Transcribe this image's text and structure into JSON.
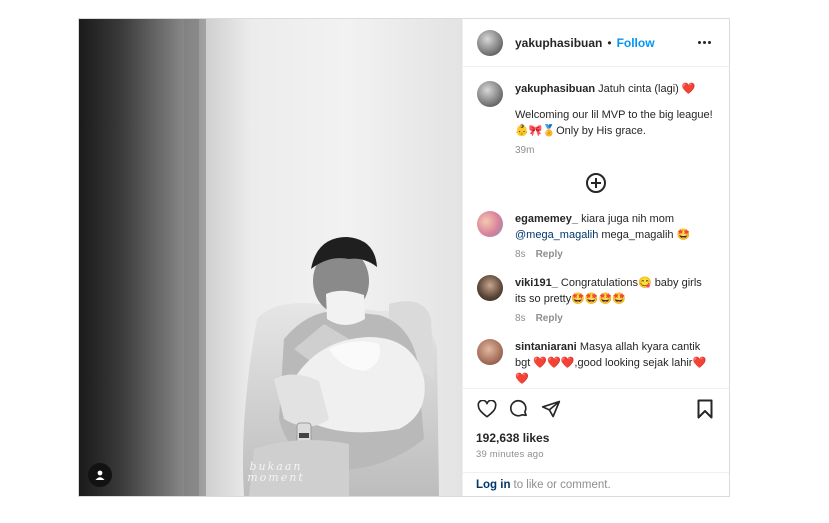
{
  "post": {
    "author": {
      "username": "yakuphasibuan",
      "separator": "•",
      "follow_label": "Follow"
    },
    "photo": {
      "watermark_line1": "bukaan",
      "watermark_line2": "moment"
    },
    "caption": {
      "username": "yakuphasibuan",
      "line1": "Jatuh cinta (lagi) ❤️",
      "line2": "Welcoming our lil MVP to the big league! 👶🎀🏅Only by His grace.",
      "time": "39m"
    },
    "comments": [
      {
        "username": "egamemey_",
        "text_before": "kiara juga nih mom",
        "mention": "@mega_magalih",
        "text_after": "mega_magalih 🤩",
        "time": "8s",
        "reply_label": "Reply"
      },
      {
        "username": "viki191_",
        "text": "Congratulations😋 baby girls its so pretty🤩🤩🤩🤩",
        "time": "8s",
        "reply_label": "Reply"
      },
      {
        "username": "sintaniarani",
        "text": "Masya allah kyara cantik bgt ❤️❤️❤️,good looking sejak lahir❤️❤️"
      }
    ],
    "likes": "192,638 likes",
    "timestamp": "39 minutes ago",
    "login": {
      "link_label": "Log in",
      "rest": "to like or comment."
    },
    "icons": {
      "like": "heart-icon",
      "comment": "comment-icon",
      "share": "share-icon",
      "save": "bookmark-icon",
      "more": "more-options-icon",
      "load_more": "plus-circle-icon",
      "user_tag": "user-tag-icon"
    },
    "colors": {
      "follow": "#0095f6",
      "link": "#00376b",
      "muted": "#8e8e8e",
      "text": "#262626"
    }
  }
}
